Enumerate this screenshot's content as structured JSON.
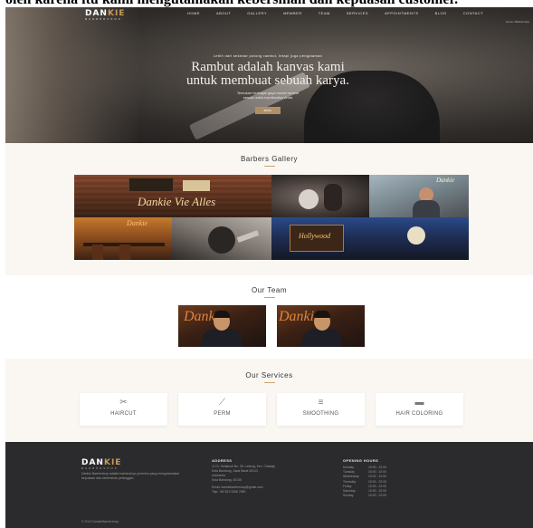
{
  "caption": "oleh karena itu kami mengutamakan kebersihan dan kepuasan customer.",
  "brand": {
    "name_main": "DAN",
    "name_accent": "KIE",
    "tagline": "BARBERSHOP"
  },
  "nav": [
    "HOME",
    "ABOUT",
    "GALLERY",
    "MEMBER",
    "TEAM",
    "SERVICES",
    "APPOINTMENTS",
    "BLOG",
    "CONTACT"
  ],
  "hero": {
    "kicker": "Lebih dari sekedar potong rambut, tetapi juga pengalaman",
    "title_line1": "Rambut adalah kanvas kami",
    "title_line2": "untuk membuat sebuah karya.",
    "subtitle_line1": "Temukan berbagai gaya model rambut",
    "subtitle_line2": "sesuai untuk kepribadian Anda",
    "button": "BOOK",
    "breadcrumb": "Home / Barbershop"
  },
  "gallery": {
    "title": "Barbers Gallery",
    "sign_main": "Dankie Vie Alles",
    "sign_neon": "Dankie",
    "sign_hollywood": "Hollywood"
  },
  "team": {
    "title": "Our Team",
    "neon": "Dankie"
  },
  "services": {
    "title": "Our Services",
    "items": [
      {
        "label": "HAIRCUT",
        "icon": "scissors-icon",
        "glyph": "✂"
      },
      {
        "label": "PERM",
        "icon": "spray-icon",
        "glyph": "⟋"
      },
      {
        "label": "SMOOTHING",
        "icon": "comb-icon",
        "glyph": "≡"
      },
      {
        "label": "HAIR COLORING",
        "icon": "brush-icon",
        "glyph": "▬"
      }
    ]
  },
  "footer": {
    "brand_main": "DAN",
    "brand_accent": "KIE",
    "brand_tagline": "BARBERSHOP",
    "desc": "Dankie Barbershop adalah barbershop premium yang mengutamakan kepuasan dan kebersihan pelanggan.",
    "address_title": "ADDRESS",
    "address_lines": [
      "Jl. Dr. Setiabudi No. 35, Ledeng, Kec. Cidadap",
      "Kota Bandung, Jawa Barat 40143",
      "Indonesia",
      "Kota Bandung, 40135",
      "Email: dankiebarbershop@gmail.com",
      "Telp: +62 812 3456 7890"
    ],
    "hours_title": "OPENING HOURS",
    "hours": [
      {
        "day": "Monday",
        "time": "10:00 - 22:00"
      },
      {
        "day": "Tuesday",
        "time": "10:00 - 22:00"
      },
      {
        "day": "Wednesday",
        "time": "10:00 - 22:00"
      },
      {
        "day": "Thursday",
        "time": "10:00 - 22:00"
      },
      {
        "day": "Friday",
        "time": "10:00 - 22:00"
      },
      {
        "day": "Saturday",
        "time": "10:00 - 22:00"
      },
      {
        "day": "Sunday",
        "time": "10:00 - 22:00"
      }
    ],
    "copyright": "© 2021 DankieBarbershop"
  },
  "colors": {
    "accent": "#c9a36d",
    "button": "#b08f67",
    "footer": "#2b2b2d",
    "section": "#faf7f3"
  }
}
